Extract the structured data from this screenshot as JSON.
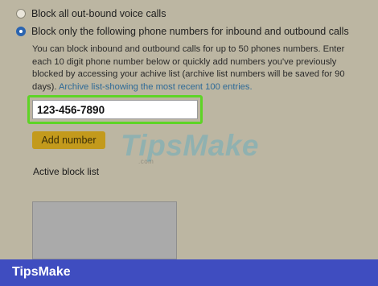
{
  "options": {
    "block_all_label": "Block all out-bound voice calls",
    "block_listed_label": "Block only the following phone numbers for inbound and outbound calls"
  },
  "description": {
    "text": "You can block inbound and outbound calls for up to 50 phones numbers. Enter each 10 digit phone number below or quickly add numbers you've previously blocked by accessing your achive list (archive list numbers will be saved for 90 days). ",
    "link": "Archive list-showing the most recent 100 entries."
  },
  "phone_input": {
    "value": "123-456-7890"
  },
  "add_button_label": "Add number",
  "active_block_list_title": "Active block list",
  "watermark": {
    "brand": "TipsMake",
    "sub": ".com"
  },
  "footer": {
    "brand": "TipsMake"
  },
  "colors": {
    "background": "#bcb6a2",
    "highlight": "#5ed426",
    "button": "#c39a1c",
    "footer": "#3f4dc0",
    "link": "#2e6a97",
    "radio_selected": "#2b64b0"
  }
}
